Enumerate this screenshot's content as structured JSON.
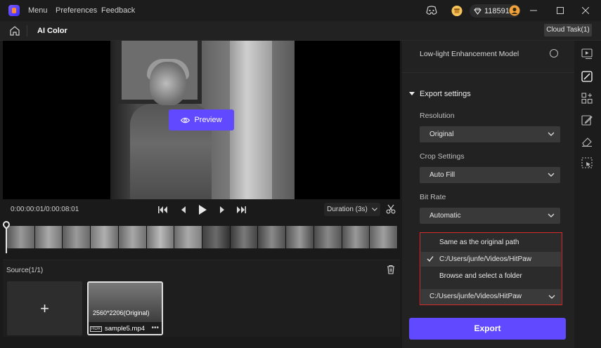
{
  "titlebar": {
    "menu_items": [
      "Menu",
      "Preferences",
      "Feedback"
    ],
    "coins": "118591"
  },
  "toolbar": {
    "title": "AI Color",
    "cloud_task": "Cloud Task(1)"
  },
  "preview": {
    "button_label": "Preview"
  },
  "playback": {
    "timecode": "0:00:00:01/0:00:08:01",
    "duration_label": "Duration (3s)"
  },
  "source": {
    "label": "Source(1/1)",
    "add_symbol": "+",
    "clip": {
      "resolution": "2560*2206(Original)",
      "name": "sample5.mp4",
      "badge": "HDR",
      "more": "•••"
    }
  },
  "settings": {
    "lowlight_label": "Low-light Enhancement Model",
    "export_title": "Export settings",
    "resolution_label": "Resolution",
    "resolution_value": "Original",
    "crop_label": "Crop Settings",
    "crop_value": "Auto Fill",
    "bitrate_label": "Bit Rate",
    "bitrate_value": "Automatic",
    "path_options": [
      "Same as the original path",
      "C:/Users/junfe/Videos/HitPaw",
      "Browse and select a folder"
    ],
    "path_value": "C:/Users/junfe/Videos/HitPaw",
    "export_label": "Export"
  },
  "colors": {
    "accent": "#6049ff",
    "highlight_border": "#d72a2a"
  }
}
